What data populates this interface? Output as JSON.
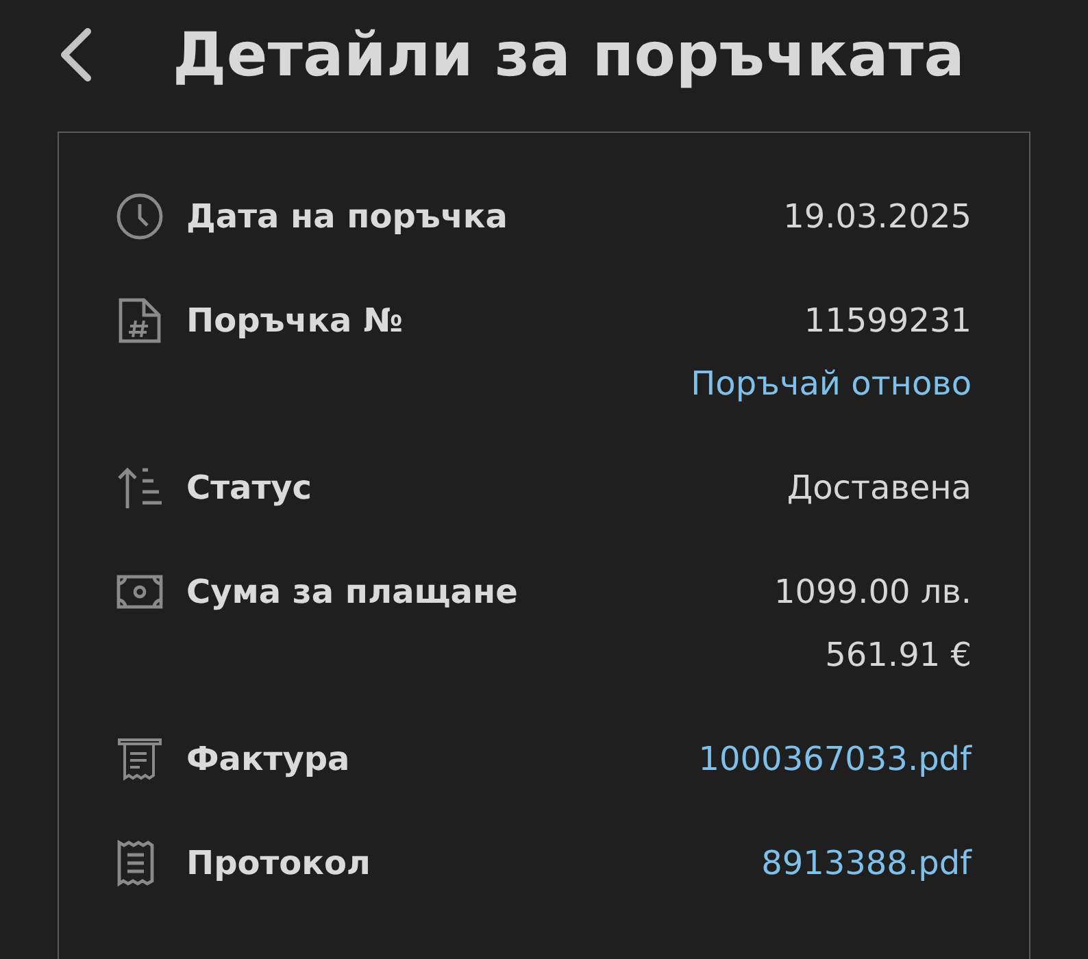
{
  "header": {
    "title": "Детайли за поръчката"
  },
  "details": [
    {
      "kind": "date",
      "label": "Дата на поръчка",
      "values": [
        {
          "kind": "text",
          "text": "19.03.2025"
        }
      ]
    },
    {
      "kind": "number",
      "label": "Поръчка №",
      "values": [
        {
          "kind": "text",
          "text": "11599231"
        },
        {
          "kind": "link",
          "text": "Поръчай отново"
        }
      ]
    },
    {
      "kind": "status",
      "label": "Статус",
      "values": [
        {
          "kind": "text",
          "text": "Доставена"
        }
      ]
    },
    {
      "kind": "amount",
      "label": "Сума за плащане",
      "values": [
        {
          "kind": "text",
          "text": "1099.00 лв."
        },
        {
          "kind": "text",
          "text": "561.91 €"
        }
      ]
    },
    {
      "kind": "invoice",
      "label": "Фактура",
      "values": [
        {
          "kind": "link",
          "text": "1000367033.pdf"
        }
      ]
    },
    {
      "kind": "protocol",
      "label": "Протокол",
      "values": [
        {
          "kind": "link",
          "text": "8913388.pdf"
        }
      ]
    }
  ]
}
